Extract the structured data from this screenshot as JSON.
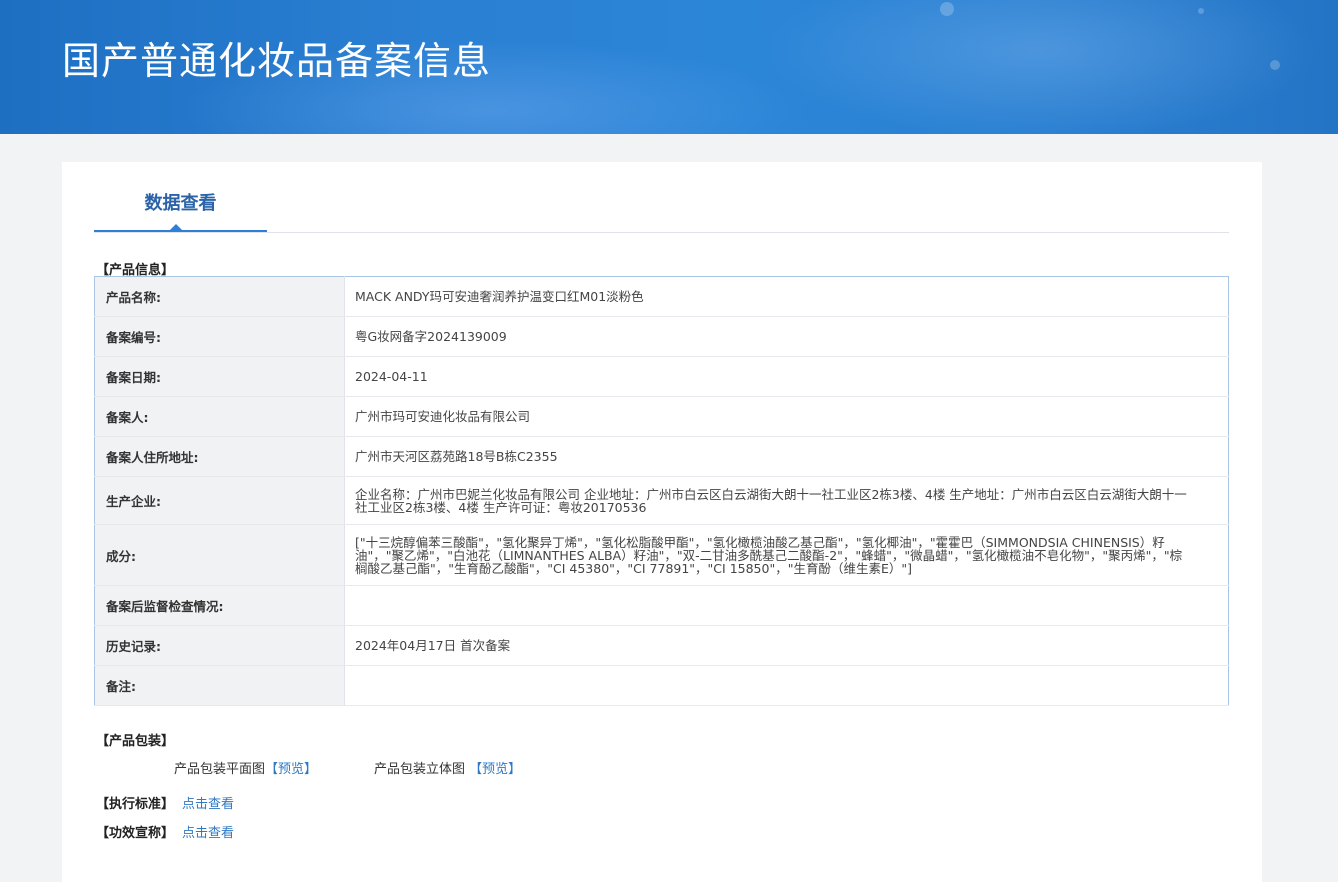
{
  "header": {
    "title": "国产普通化妆品备案信息"
  },
  "tabs": [
    {
      "label": "数据查看"
    }
  ],
  "product_info": {
    "section_label": "【产品信息】",
    "rows": [
      {
        "label": "产品名称:",
        "value": "MACK ANDY玛可安迪奢润养护温变口红M01淡粉色"
      },
      {
        "label": "备案编号:",
        "value": "粤G妆网备字2024139009"
      },
      {
        "label": "备案日期:",
        "value": "2024-04-11"
      },
      {
        "label": "备案人:",
        "value": "广州市玛可安迪化妆品有限公司"
      },
      {
        "label": "备案人住所地址:",
        "value": "广州市天河区荔苑路18号B栋C2355"
      },
      {
        "label": "生产企业:",
        "value": "企业名称：广州市巴妮兰化妆品有限公司 企业地址：广州市白云区白云湖街大朗十一社工业区2栋3楼、4楼 生产地址：广州市白云区白云湖街大朗十一社工业区2栋3楼、4楼 生产许可证：粤妆20170536"
      },
      {
        "label": "成分:",
        "value": "[\"十三烷醇偏苯三酸酯\"，\"氢化聚异丁烯\"，\"氢化松脂酸甲酯\"，\"氢化橄榄油酸乙基己酯\"，\"氢化椰油\"，\"霍霍巴（SIMMONDSIA CHINENSIS）籽油\"，\"聚乙烯\"，\"白池花（LIMNANTHES ALBA）籽油\"，\"双-二甘油多酰基己二酸酯-2\"，\"蜂蜡\"，\"微晶蜡\"，\"氢化橄榄油不皂化物\"，\"聚丙烯\"，\"棕榈酸乙基己酯\"，\"生育酚乙酸酯\"，\"CI 45380\"，\"CI 77891\"，\"CI 15850\"，\"生育酚（维生素E）\"]"
      },
      {
        "label": "备案后监督检查情况:",
        "value": ""
      },
      {
        "label": "历史记录:",
        "value": "2024年04月17日 首次备案"
      },
      {
        "label": "备注:",
        "value": ""
      }
    ]
  },
  "packaging": {
    "section_label": "【产品包装】",
    "flat_label": "产品包装平面图",
    "flat_link": "【预览】",
    "stereo_label": "产品包装立体图",
    "stereo_link": "【预览】"
  },
  "standard": {
    "label": "【执行标准】",
    "link": "点击查看"
  },
  "efficacy": {
    "label": "【功效宣称】",
    "link": "点击查看"
  }
}
